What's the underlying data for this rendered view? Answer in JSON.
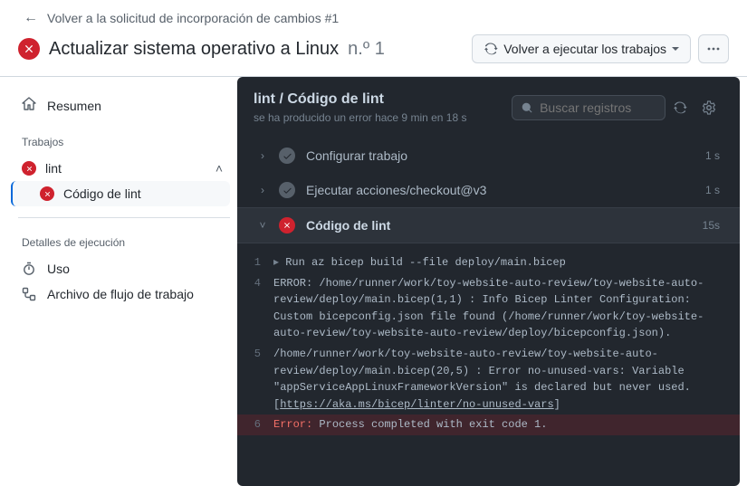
{
  "back_link": "Volver a la solicitud de incorporación de cambios #1",
  "title": "Actualizar sistema operativo a Linux",
  "run_number": "n.º 1",
  "rerun_button": "Volver a ejecutar los trabajos",
  "sidebar": {
    "summary": "Resumen",
    "jobs_label": "Trabajos",
    "job_name": "lint",
    "step_name": "Código de lint",
    "details_label": "Detalles de ejecución",
    "usage": "Uso",
    "workflow_file": "Archivo de flujo de trabajo"
  },
  "log": {
    "title": "lint / Código de lint",
    "subtitle": "se ha producido un error hace 9 min en 18 s",
    "search_placeholder": "Buscar registros",
    "steps": [
      {
        "name": "Configurar trabajo",
        "status": "success",
        "time": "1 s",
        "expanded": false
      },
      {
        "name": "Ejecutar acciones/checkout@v3",
        "status": "success",
        "time": "1 s",
        "expanded": false
      },
      {
        "name": "Código de lint",
        "status": "failure",
        "time": "15s",
        "expanded": true
      }
    ],
    "lines": [
      {
        "n": "1",
        "text": "▸ Run az bicep build --file deploy/main.bicep",
        "err": false,
        "hasTri": true
      },
      {
        "n": "4",
        "text": "ERROR: /home/runner/work/toy-website-auto-review/toy-website-auto-review/deploy/main.bicep(1,1) : Info Bicep Linter Configuration: Custom bicepconfig.json file found (/home/runner/work/toy-website-auto-review/toy-website-auto-review/deploy/bicepconfig.json).",
        "err": false
      },
      {
        "n": "5",
        "text": "/home/runner/work/toy-website-auto-review/toy-website-auto-review/deploy/main.bicep(20,5) : Error no-unused-vars: Variable \"appServiceAppLinuxFrameworkVersion\" is declared but never used. [https://aka.ms/bicep/linter/no-unused-vars]",
        "err": false,
        "hasLink": true,
        "linkText": "https://aka.ms/bicep/linter/no-unused-vars"
      },
      {
        "n": "6",
        "prefix": "Error:",
        "text": " Process completed with exit code 1.",
        "err": true
      }
    ]
  }
}
